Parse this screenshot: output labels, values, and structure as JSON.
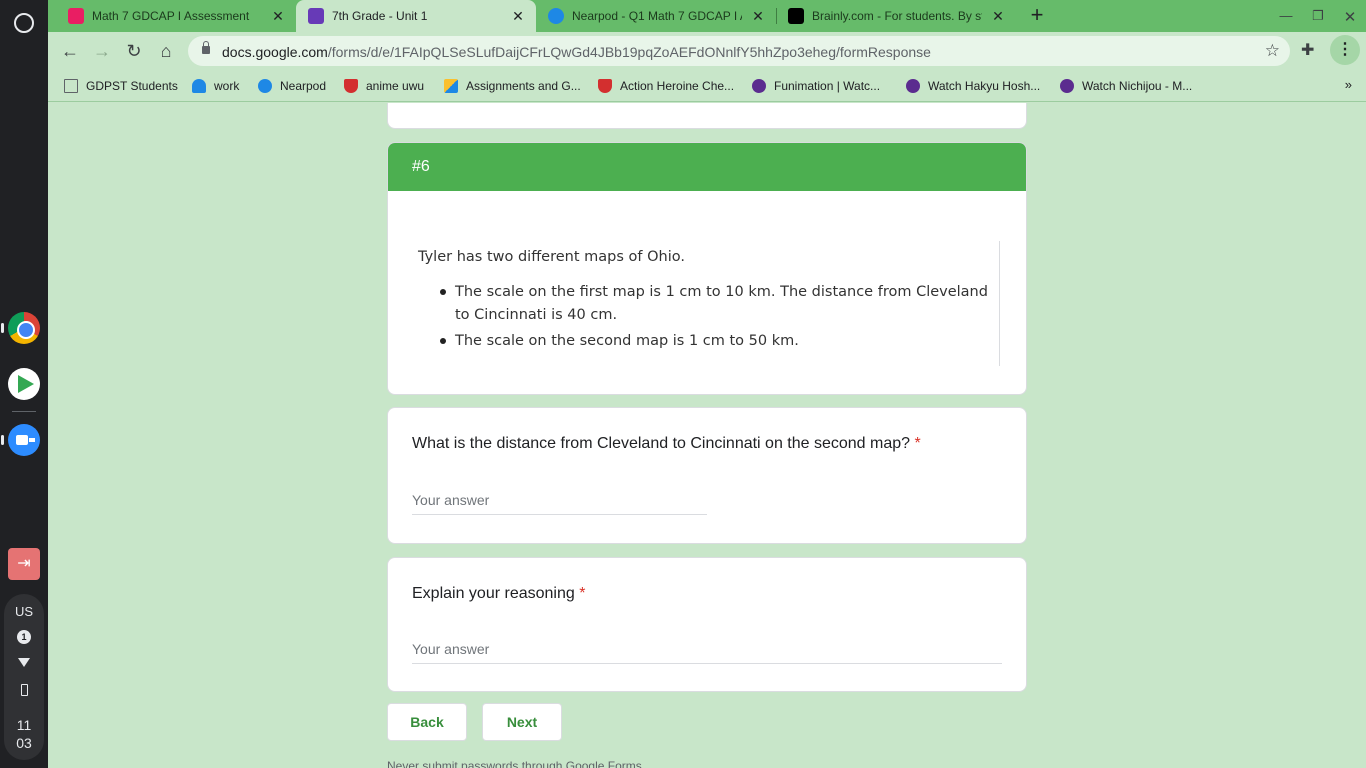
{
  "browser": {
    "tabs": [
      {
        "title": "Math 7 GDCAP I Assessment",
        "favicon_color": "#e91e63",
        "active": false
      },
      {
        "title": "7th Grade - Unit 1",
        "favicon_color": "#673ab7",
        "active": true
      },
      {
        "title": "Nearpod - Q1 Math 7 GDCAP I A",
        "favicon_color": "#1e88e5",
        "active": false
      },
      {
        "title": "Brainly.com - For students. By st",
        "favicon_color": "#000000",
        "active": false
      }
    ],
    "new_tab_label": "+",
    "url_host": "docs.google.com",
    "url_path": "/forms/d/e/1FAIpQLSeSLufDaijCFrLQwGd4JBb19pqZoAEFdONnlfY5hhZpo3eheg/formResponse",
    "bookmarks": [
      {
        "label": "GDPST Students",
        "icon_color": "#5f6368"
      },
      {
        "label": "work",
        "icon_color": "#1e88e5"
      },
      {
        "label": "Nearpod",
        "icon_color": "#1e88e5"
      },
      {
        "label": "anime uwu",
        "icon_color": "#d32f2f"
      },
      {
        "label": "Assignments and G...",
        "icon_color": "#fbc02d"
      },
      {
        "label": "Action Heroine Che...",
        "icon_color": "#d32f2f"
      },
      {
        "label": "Funimation | Watc...",
        "icon_color": "#5b2c8f"
      },
      {
        "label": "Watch Hakyu Hosh...",
        "icon_color": "#5b2c8f"
      },
      {
        "label": "Watch Nichijou - M...",
        "icon_color": "#5b2c8f"
      }
    ],
    "bookmarks_more": "»"
  },
  "system": {
    "lang": "US",
    "notification_count": "1",
    "time_hour": "11",
    "time_min": "03"
  },
  "form": {
    "section_title": "#6",
    "passage": {
      "intro": "Tyler has two different maps of Ohio.",
      "bullets": [
        "The scale on the first map is 1 cm to 10 km. The distance from Cleveland to Cincinnati is 40 cm.",
        "The scale on the second map is 1 cm to 50 km."
      ]
    },
    "questions": [
      {
        "title": "What is the distance from Cleveland to Cincinnati on the second map?",
        "required_mark": "*",
        "placeholder": "Your answer"
      },
      {
        "title": "Explain your reasoning",
        "required_mark": "*",
        "placeholder": "Your answer"
      }
    ],
    "back_label": "Back",
    "next_label": "Next",
    "footer": "Never submit passwords through Google Forms."
  },
  "colors": {
    "page_background": "#c8e6c9",
    "header_green": "#4caf50",
    "button_text": "#388e3c",
    "required": "#d93025"
  }
}
